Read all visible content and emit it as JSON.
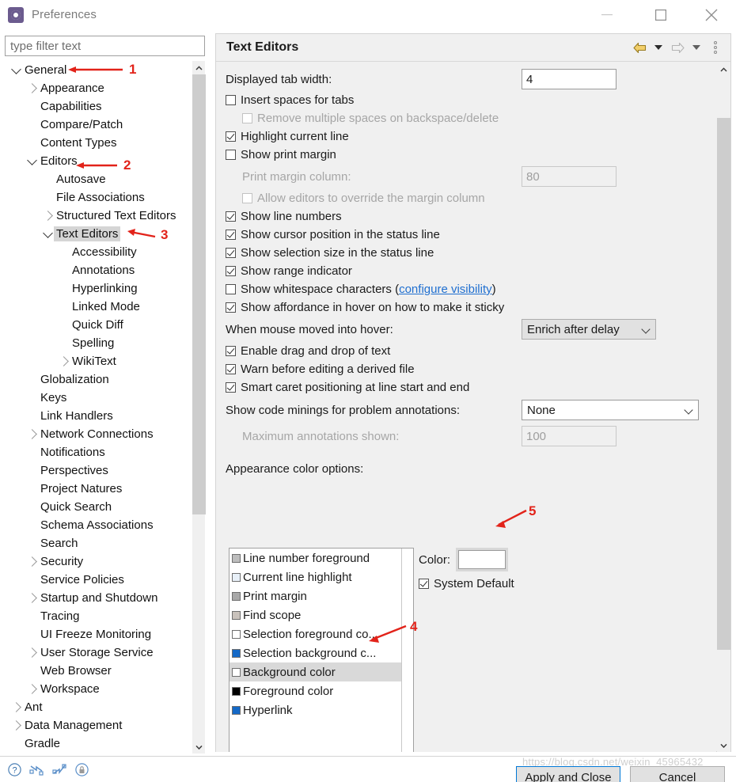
{
  "window": {
    "title": "Preferences",
    "icon": "preferences-gear-icon",
    "minimize_label": "Minimize",
    "maximize_label": "Maximize",
    "close_label": "Close"
  },
  "search": {
    "placeholder": "type filter text",
    "value": ""
  },
  "tree": {
    "items": [
      {
        "label": "General",
        "depth": 0,
        "twisty": "down",
        "selected": false
      },
      {
        "label": "Appearance",
        "depth": 1,
        "twisty": "right",
        "selected": false
      },
      {
        "label": "Capabilities",
        "depth": 1,
        "twisty": "none",
        "selected": false
      },
      {
        "label": "Compare/Patch",
        "depth": 1,
        "twisty": "none",
        "selected": false
      },
      {
        "label": "Content Types",
        "depth": 1,
        "twisty": "none",
        "selected": false
      },
      {
        "label": "Editors",
        "depth": 1,
        "twisty": "down",
        "selected": false
      },
      {
        "label": "Autosave",
        "depth": 2,
        "twisty": "none",
        "selected": false
      },
      {
        "label": "File Associations",
        "depth": 2,
        "twisty": "none",
        "selected": false
      },
      {
        "label": "Structured Text Editors",
        "depth": 2,
        "twisty": "right",
        "selected": false
      },
      {
        "label": "Text Editors",
        "depth": 2,
        "twisty": "down",
        "selected": true
      },
      {
        "label": "Accessibility",
        "depth": 3,
        "twisty": "none",
        "selected": false
      },
      {
        "label": "Annotations",
        "depth": 3,
        "twisty": "none",
        "selected": false
      },
      {
        "label": "Hyperlinking",
        "depth": 3,
        "twisty": "none",
        "selected": false
      },
      {
        "label": "Linked Mode",
        "depth": 3,
        "twisty": "none",
        "selected": false
      },
      {
        "label": "Quick Diff",
        "depth": 3,
        "twisty": "none",
        "selected": false
      },
      {
        "label": "Spelling",
        "depth": 3,
        "twisty": "none",
        "selected": false
      },
      {
        "label": "WikiText",
        "depth": 3,
        "twisty": "right",
        "selected": false
      },
      {
        "label": "Globalization",
        "depth": 1,
        "twisty": "none",
        "selected": false
      },
      {
        "label": "Keys",
        "depth": 1,
        "twisty": "none",
        "selected": false
      },
      {
        "label": "Link Handlers",
        "depth": 1,
        "twisty": "none",
        "selected": false
      },
      {
        "label": "Network Connections",
        "depth": 1,
        "twisty": "right",
        "selected": false
      },
      {
        "label": "Notifications",
        "depth": 1,
        "twisty": "none",
        "selected": false
      },
      {
        "label": "Perspectives",
        "depth": 1,
        "twisty": "none",
        "selected": false
      },
      {
        "label": "Project Natures",
        "depth": 1,
        "twisty": "none",
        "selected": false
      },
      {
        "label": "Quick Search",
        "depth": 1,
        "twisty": "none",
        "selected": false
      },
      {
        "label": "Schema Associations",
        "depth": 1,
        "twisty": "none",
        "selected": false
      },
      {
        "label": "Search",
        "depth": 1,
        "twisty": "none",
        "selected": false
      },
      {
        "label": "Security",
        "depth": 1,
        "twisty": "right",
        "selected": false
      },
      {
        "label": "Service Policies",
        "depth": 1,
        "twisty": "none",
        "selected": false
      },
      {
        "label": "Startup and Shutdown",
        "depth": 1,
        "twisty": "right",
        "selected": false
      },
      {
        "label": "Tracing",
        "depth": 1,
        "twisty": "none",
        "selected": false
      },
      {
        "label": "UI Freeze Monitoring",
        "depth": 1,
        "twisty": "none",
        "selected": false
      },
      {
        "label": "User Storage Service",
        "depth": 1,
        "twisty": "right",
        "selected": false
      },
      {
        "label": "Web Browser",
        "depth": 1,
        "twisty": "none",
        "selected": false
      },
      {
        "label": "Workspace",
        "depth": 1,
        "twisty": "right",
        "selected": false
      },
      {
        "label": "Ant",
        "depth": 0,
        "twisty": "right",
        "selected": false
      },
      {
        "label": "Data Management",
        "depth": 0,
        "twisty": "right",
        "selected": false
      },
      {
        "label": "Gradle",
        "depth": 0,
        "twisty": "none",
        "selected": false
      }
    ]
  },
  "page": {
    "title": "Text Editors",
    "toolbar": {
      "back_icon": "back-arrow-icon",
      "back_menu_icon": "chevron-down-icon",
      "forward_icon": "forward-arrow-icon",
      "forward_menu_icon": "chevron-down-icon",
      "view_menu_icon": "vertical-dots-icon"
    },
    "fields": {
      "displayed_tab_width_label": "Displayed tab width:",
      "displayed_tab_width_value": "4",
      "print_margin_column_label": "Print margin column:",
      "print_margin_column_value": "80",
      "when_mouse_hover_label": "When mouse moved into hover:",
      "when_mouse_hover_value": "Enrich after delay",
      "code_minings_label": "Show code minings for problem annotations:",
      "code_minings_value": "None",
      "max_annotations_label": "Maximum annotations shown:",
      "max_annotations_value": "100",
      "appearance_color_options_label": "Appearance color options:",
      "color_label": "Color:",
      "system_default_label": "System Default",
      "system_default_checked": true
    },
    "checkboxes": [
      {
        "label": "Insert spaces for tabs",
        "checked": false,
        "enabled": true
      },
      {
        "label": "Remove multiple spaces on backspace/delete",
        "checked": false,
        "enabled": false
      },
      {
        "label": "Highlight current line",
        "checked": true,
        "enabled": true
      },
      {
        "label": "Show print margin",
        "checked": false,
        "enabled": true
      },
      {
        "label": "Allow editors to override the margin column",
        "checked": false,
        "enabled": false
      },
      {
        "label": "Show line numbers",
        "checked": true,
        "enabled": true
      },
      {
        "label": "Show cursor position in the status line",
        "checked": true,
        "enabled": true
      },
      {
        "label": "Show selection size in the status line",
        "checked": true,
        "enabled": true
      },
      {
        "label": "Show range indicator",
        "checked": true,
        "enabled": true
      },
      {
        "label": "Show whitespace characters (",
        "checked": false,
        "enabled": true,
        "link": "configure visibility",
        "suffix": ")"
      },
      {
        "label": "Show affordance in hover on how to make it sticky",
        "checked": true,
        "enabled": true
      },
      {
        "label": "Enable drag and drop of text",
        "checked": true,
        "enabled": true
      },
      {
        "label": "Warn before editing a derived file",
        "checked": true,
        "enabled": true
      },
      {
        "label": "Smart caret positioning at line start and end",
        "checked": true,
        "enabled": true
      }
    ],
    "color_list": [
      {
        "label": "Line number foreground",
        "swatch": "#bdbdbd",
        "selected": false
      },
      {
        "label": "Current line highlight",
        "swatch": "#e8f0f8",
        "selected": false
      },
      {
        "label": "Print margin",
        "swatch": "#a8a8a8",
        "selected": false
      },
      {
        "label": "Find scope",
        "swatch": "#c9c2bc",
        "selected": false
      },
      {
        "label": "Selection foreground co...",
        "swatch": "#ffffff",
        "selected": false
      },
      {
        "label": "Selection background c...",
        "swatch": "#1469c7",
        "selected": false
      },
      {
        "label": "Background color",
        "swatch": "#ffffff",
        "selected": true
      },
      {
        "label": "Foreground color",
        "swatch": "#000000",
        "selected": false
      },
      {
        "label": "Hyperlink",
        "swatch": "#1469c7",
        "selected": false
      }
    ],
    "color_swatch_value": "#ffffff"
  },
  "annotations": [
    {
      "number": "1",
      "target": "tree-item-general"
    },
    {
      "number": "2",
      "target": "tree-item-editors"
    },
    {
      "number": "3",
      "target": "tree-item-text-editors"
    },
    {
      "number": "4",
      "target": "color-list-background-color"
    },
    {
      "number": "5",
      "target": "color-swatch"
    }
  ],
  "footer": {
    "help_icon": "help-question-icon",
    "import_icon": "import-arrow-icon",
    "export_icon": "export-arrow-icon",
    "secure_icon": "lock-icon",
    "apply_label": "Apply and Close",
    "cancel_label": "Cancel"
  },
  "watermark": {
    "text": "https://blog.csdn.net/weixin_45965432"
  }
}
